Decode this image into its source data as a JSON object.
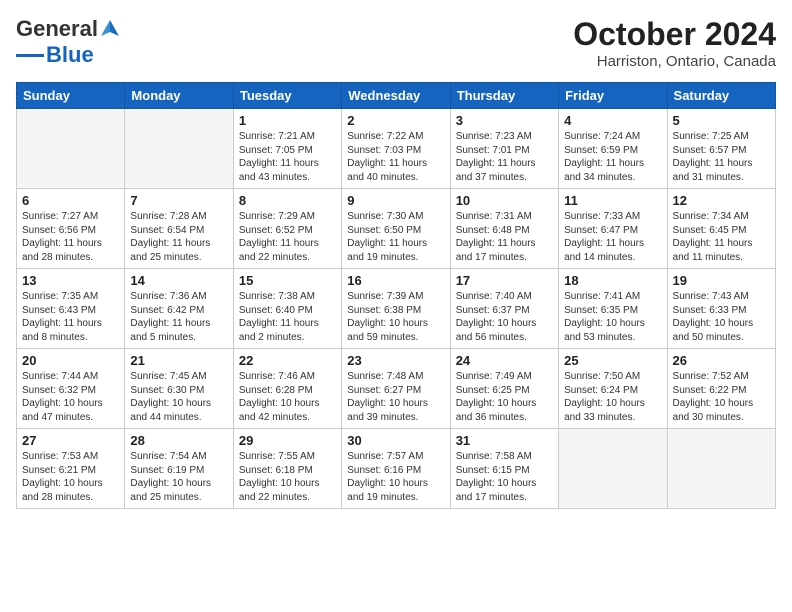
{
  "logo": {
    "line1": "General",
    "line2": "Blue"
  },
  "title": "October 2024",
  "subtitle": "Harriston, Ontario, Canada",
  "days_of_week": [
    "Sunday",
    "Monday",
    "Tuesday",
    "Wednesday",
    "Thursday",
    "Friday",
    "Saturday"
  ],
  "weeks": [
    [
      {
        "day": null,
        "sunrise": null,
        "sunset": null,
        "daylight": null
      },
      {
        "day": null,
        "sunrise": null,
        "sunset": null,
        "daylight": null
      },
      {
        "day": "1",
        "sunrise": "7:21 AM",
        "sunset": "7:05 PM",
        "daylight": "11 hours and 43 minutes."
      },
      {
        "day": "2",
        "sunrise": "7:22 AM",
        "sunset": "7:03 PM",
        "daylight": "11 hours and 40 minutes."
      },
      {
        "day": "3",
        "sunrise": "7:23 AM",
        "sunset": "7:01 PM",
        "daylight": "11 hours and 37 minutes."
      },
      {
        "day": "4",
        "sunrise": "7:24 AM",
        "sunset": "6:59 PM",
        "daylight": "11 hours and 34 minutes."
      },
      {
        "day": "5",
        "sunrise": "7:25 AM",
        "sunset": "6:57 PM",
        "daylight": "11 hours and 31 minutes."
      }
    ],
    [
      {
        "day": "6",
        "sunrise": "7:27 AM",
        "sunset": "6:56 PM",
        "daylight": "11 hours and 28 minutes."
      },
      {
        "day": "7",
        "sunrise": "7:28 AM",
        "sunset": "6:54 PM",
        "daylight": "11 hours and 25 minutes."
      },
      {
        "day": "8",
        "sunrise": "7:29 AM",
        "sunset": "6:52 PM",
        "daylight": "11 hours and 22 minutes."
      },
      {
        "day": "9",
        "sunrise": "7:30 AM",
        "sunset": "6:50 PM",
        "daylight": "11 hours and 19 minutes."
      },
      {
        "day": "10",
        "sunrise": "7:31 AM",
        "sunset": "6:48 PM",
        "daylight": "11 hours and 17 minutes."
      },
      {
        "day": "11",
        "sunrise": "7:33 AM",
        "sunset": "6:47 PM",
        "daylight": "11 hours and 14 minutes."
      },
      {
        "day": "12",
        "sunrise": "7:34 AM",
        "sunset": "6:45 PM",
        "daylight": "11 hours and 11 minutes."
      }
    ],
    [
      {
        "day": "13",
        "sunrise": "7:35 AM",
        "sunset": "6:43 PM",
        "daylight": "11 hours and 8 minutes."
      },
      {
        "day": "14",
        "sunrise": "7:36 AM",
        "sunset": "6:42 PM",
        "daylight": "11 hours and 5 minutes."
      },
      {
        "day": "15",
        "sunrise": "7:38 AM",
        "sunset": "6:40 PM",
        "daylight": "11 hours and 2 minutes."
      },
      {
        "day": "16",
        "sunrise": "7:39 AM",
        "sunset": "6:38 PM",
        "daylight": "10 hours and 59 minutes."
      },
      {
        "day": "17",
        "sunrise": "7:40 AM",
        "sunset": "6:37 PM",
        "daylight": "10 hours and 56 minutes."
      },
      {
        "day": "18",
        "sunrise": "7:41 AM",
        "sunset": "6:35 PM",
        "daylight": "10 hours and 53 minutes."
      },
      {
        "day": "19",
        "sunrise": "7:43 AM",
        "sunset": "6:33 PM",
        "daylight": "10 hours and 50 minutes."
      }
    ],
    [
      {
        "day": "20",
        "sunrise": "7:44 AM",
        "sunset": "6:32 PM",
        "daylight": "10 hours and 47 minutes."
      },
      {
        "day": "21",
        "sunrise": "7:45 AM",
        "sunset": "6:30 PM",
        "daylight": "10 hours and 44 minutes."
      },
      {
        "day": "22",
        "sunrise": "7:46 AM",
        "sunset": "6:28 PM",
        "daylight": "10 hours and 42 minutes."
      },
      {
        "day": "23",
        "sunrise": "7:48 AM",
        "sunset": "6:27 PM",
        "daylight": "10 hours and 39 minutes."
      },
      {
        "day": "24",
        "sunrise": "7:49 AM",
        "sunset": "6:25 PM",
        "daylight": "10 hours and 36 minutes."
      },
      {
        "day": "25",
        "sunrise": "7:50 AM",
        "sunset": "6:24 PM",
        "daylight": "10 hours and 33 minutes."
      },
      {
        "day": "26",
        "sunrise": "7:52 AM",
        "sunset": "6:22 PM",
        "daylight": "10 hours and 30 minutes."
      }
    ],
    [
      {
        "day": "27",
        "sunrise": "7:53 AM",
        "sunset": "6:21 PM",
        "daylight": "10 hours and 28 minutes."
      },
      {
        "day": "28",
        "sunrise": "7:54 AM",
        "sunset": "6:19 PM",
        "daylight": "10 hours and 25 minutes."
      },
      {
        "day": "29",
        "sunrise": "7:55 AM",
        "sunset": "6:18 PM",
        "daylight": "10 hours and 22 minutes."
      },
      {
        "day": "30",
        "sunrise": "7:57 AM",
        "sunset": "6:16 PM",
        "daylight": "10 hours and 19 minutes."
      },
      {
        "day": "31",
        "sunrise": "7:58 AM",
        "sunset": "6:15 PM",
        "daylight": "10 hours and 17 minutes."
      },
      {
        "day": null,
        "sunrise": null,
        "sunset": null,
        "daylight": null
      },
      {
        "day": null,
        "sunrise": null,
        "sunset": null,
        "daylight": null
      }
    ]
  ]
}
